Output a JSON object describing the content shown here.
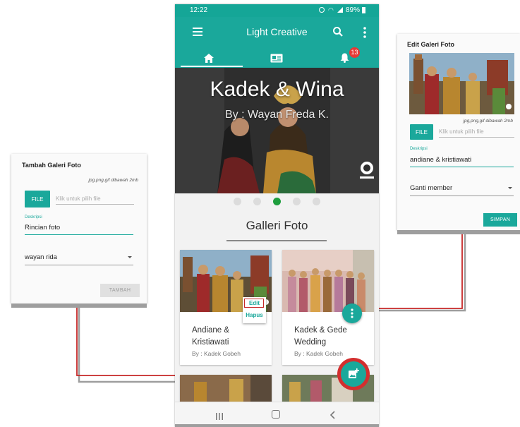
{
  "colors": {
    "primary": "#1aa89b",
    "accent_red": "#c62828",
    "active_dot": "#1e9e3e"
  },
  "dialog_left": {
    "title": "Tambah Galeri Foto",
    "hint": "jpg,png,gif dibawah 2mb",
    "file_button": "FILE",
    "file_placeholder": "Klik untuk pilih file",
    "desc_label": "Deskripsi",
    "desc_value": "Rincian foto",
    "select_value": "wayan rida",
    "submit": "TAMBAH"
  },
  "dialog_right": {
    "title": "Edit Galeri Foto",
    "hint": "jpg,png,gif dibawah 2mb",
    "file_button": "FILE",
    "file_placeholder": "Klik untuk pilih file",
    "desc_label": "Deskripsi",
    "desc_value": "andiane & kristiawati",
    "select_value": "Ganti member",
    "submit": "SIMPAN"
  },
  "phone": {
    "status": {
      "time": "12:22",
      "battery": "89%"
    },
    "app_title": "Light Creative",
    "tabs": [
      {
        "icon": "home-icon"
      },
      {
        "icon": "id-card-icon"
      },
      {
        "icon": "notification-bell-icon",
        "badge": "13"
      }
    ],
    "hero": {
      "title": "Kadek & Wina",
      "subtitle": "By : Wayan Freda K."
    },
    "carousel": {
      "count": 5,
      "active": 3
    },
    "section_title": "Galleri Foto",
    "cards": [
      {
        "title_line1": "Andiane &",
        "title_line2": "Kristiawati",
        "by": "By : Kadek Gobeh"
      },
      {
        "title_line1": "Kadek & Gede",
        "title_line2": "Wedding",
        "by": "By : Kadek Gobeh"
      }
    ],
    "popup_menu": {
      "edit": "Edit",
      "delete": "Hapus"
    }
  }
}
